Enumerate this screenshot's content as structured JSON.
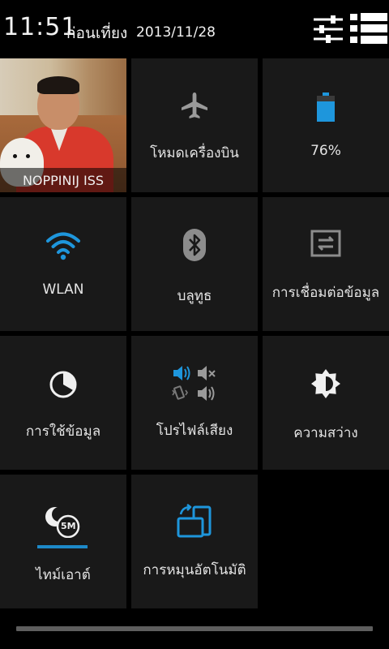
{
  "status_bar": {
    "time": "11:51",
    "ampm": "ก่อนเที่ยง",
    "date": "2013/11/28",
    "settings_icon": "quick-settings-sliders-icon",
    "notifications_icon": "notifications-list-icon"
  },
  "tiles": {
    "profile": {
      "name": "NOPPINIJ ISS"
    },
    "airplane": {
      "label": "โหมดเครื่องบิน",
      "icon": "airplane-icon"
    },
    "battery": {
      "label": "76%",
      "level_percent": 76,
      "icon": "battery-icon"
    },
    "wlan": {
      "label": "WLAN",
      "icon": "wifi-icon"
    },
    "bluetooth": {
      "label": "บลูทูธ",
      "icon": "bluetooth-icon"
    },
    "data_connection": {
      "label": "การเชื่อมต่อข้อมูล",
      "icon": "data-connection-icon"
    },
    "data_usage": {
      "label": "การใช้ข้อมูล",
      "icon": "data-usage-icon"
    },
    "sound_profile": {
      "label": "โปรไฟล์เสียง",
      "icon": "sound-profile-icon"
    },
    "brightness": {
      "label": "ความสว่าง",
      "icon": "brightness-icon"
    },
    "timeout": {
      "label": "ไทม์เอาต์",
      "badge": "5M",
      "icon": "timeout-icon"
    },
    "auto_rotate": {
      "label": "การหมุนอัตโนมัติ",
      "icon": "auto-rotate-icon"
    }
  },
  "colors": {
    "accent": "#1e96dc",
    "tile_background": "#191919",
    "icon_grey": "#9a9a9a"
  }
}
